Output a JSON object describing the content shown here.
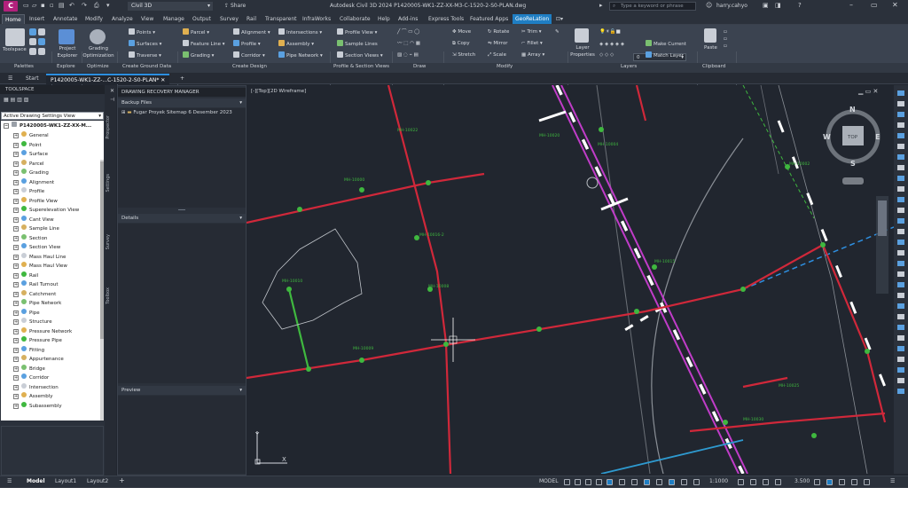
{
  "app": {
    "title": "Autodesk Civil 3D 2024   P1420005-WK1-ZZ-XX-M3-C-1520-2-S0-PLAN.dwg",
    "workspace": "Civil 3D",
    "share": "Share",
    "search_placeholder": "Type a keyword or phrase",
    "user": "harry.cahyo",
    "app_letter": "C"
  },
  "menu_tabs": [
    "Home",
    "Insert",
    "Annotate",
    "Modify",
    "Analyze",
    "View",
    "Manage",
    "Output",
    "Survey",
    "Rail",
    "Transparent",
    "InfraWorks",
    "Collaborate",
    "Help",
    "Add-ins",
    "Express Tools",
    "Featured Apps",
    "GeoReLation"
  ],
  "ribbon": {
    "toolspace": "Toolspace",
    "project_explorer": "Project Explorer",
    "grading_optimization": "Grading Optimization",
    "points": "Points",
    "surfaces": "Surfaces",
    "traverse": "Traverse",
    "parcel": "Parcel",
    "feature_line": "Feature Line",
    "grading": "Grading",
    "alignment": "Alignment",
    "profile": "Profile",
    "corridor": "Corridor",
    "intersections": "Intersections",
    "assembly": "Assembly",
    "pipe_network": "Pipe Network",
    "profile_view": "Profile View",
    "sample_lines": "Sample Lines",
    "section_views": "Section Views",
    "move": "Move",
    "copy": "Copy",
    "stretch": "Stretch",
    "rotate": "Rotate",
    "mirror": "Mirror",
    "scale": "Scale",
    "trim": "Trim",
    "fillet": "Fillet",
    "array": "Array",
    "layer_properties": "Layer Properties",
    "layer_value": "0",
    "make_current": "Make Current",
    "match_layer": "Match Layer",
    "paste": "Paste",
    "panels": [
      "Palettes",
      "Explore",
      "Optimize",
      "Create Ground Data",
      "Create Design",
      "Profile & Section Views",
      "Draw",
      "Modify",
      "Layers",
      "Clipboard"
    ]
  },
  "doc_tabs": {
    "start": "Start",
    "active": "P1420005-WK1-ZZ-...C-1520-2-S0-PLAN*"
  },
  "toolspace": {
    "header": "TOOLSPACE",
    "view": "Active Drawing Settings View",
    "root": "P1420005-WK1-ZZ-XX-M...",
    "items": [
      "General",
      "Point",
      "Surface",
      "Parcel",
      "Grading",
      "Alignment",
      "Profile",
      "Profile View",
      "Superelevation View",
      "Cant View",
      "Sample Line",
      "Section",
      "Section View",
      "Mass Haul Line",
      "Mass Haul View",
      "Rail",
      "Rail Turnout",
      "Catchment",
      "Pipe Network",
      "Pipe",
      "Structure",
      "Pressure Network",
      "Pressure Pipe",
      "Fitting",
      "Appurtenance",
      "Bridge",
      "Corridor",
      "Intersection",
      "Assembly",
      "Subassembly"
    ],
    "side_tabs": [
      "Prospector",
      "Settings",
      "Survey",
      "Toolbox"
    ]
  },
  "recovery": {
    "title": "DRAWING RECOVERY MANAGER",
    "backup_files": "Backup Files",
    "folder": "Fugar Proyek Sitemap 6 Desember 2023",
    "details": "Details",
    "preview": "Preview"
  },
  "viewport": {
    "label": "[-][Top][2D Wireframe]",
    "compass": {
      "n": "N",
      "s": "S",
      "e": "E",
      "w": "W",
      "top": "TOP"
    },
    "axis_x": "X",
    "axis_y": "Y",
    "labels": [
      "MH-10000",
      "MH-10022",
      "MH-10016-2",
      "MH-10008",
      "MH-10009",
      "MH-10010",
      "MH-10020",
      "MH-10004",
      "MH-10015",
      "MH-10002",
      "MH-10025",
      "MH-10030"
    ]
  },
  "layout_tabs": [
    "Model",
    "Layout1",
    "Layout2"
  ],
  "status": {
    "model": "MODEL",
    "scale": "1:1000",
    "value": "3.500"
  },
  "colors": {
    "accent": "#1f7ec3",
    "canvas": "#21262f",
    "pipe_red": "#d0283a",
    "label_green": "#3fb83f",
    "road_magenta": "#c03cc8"
  }
}
